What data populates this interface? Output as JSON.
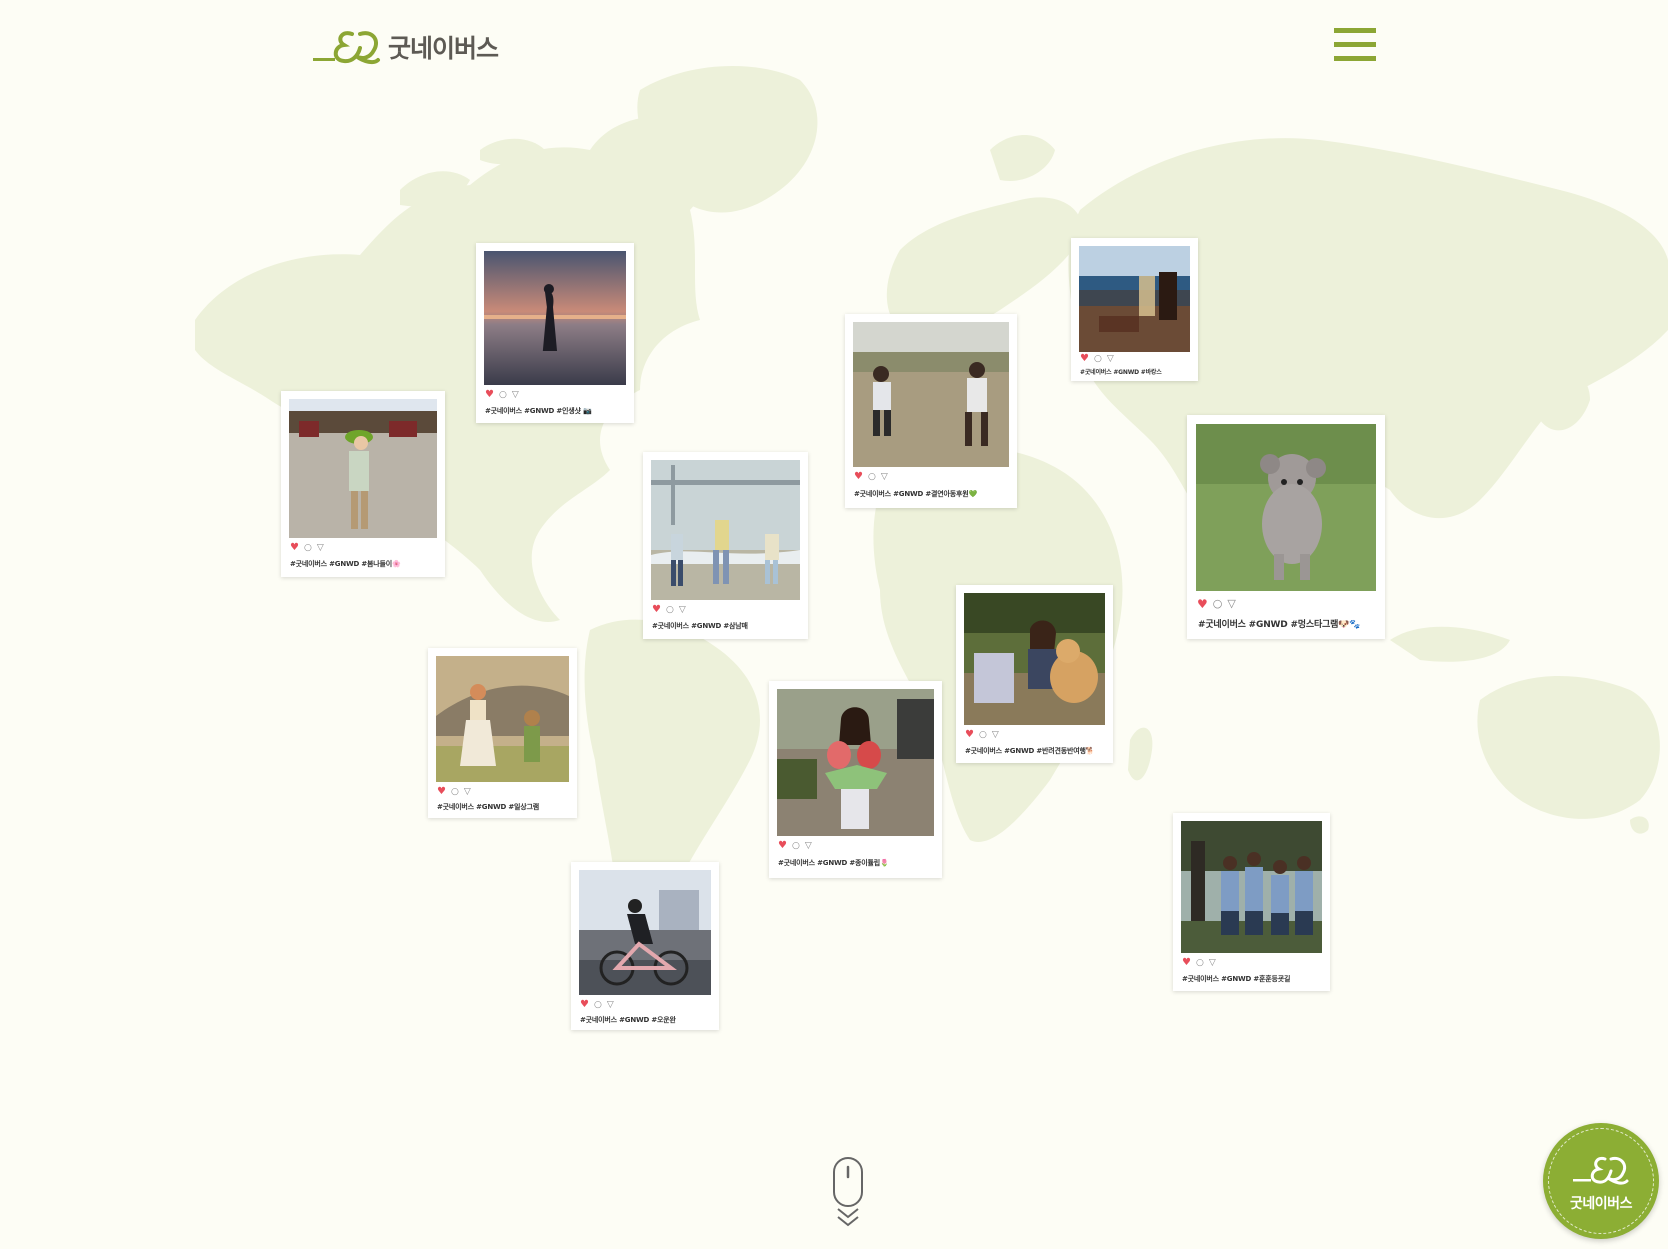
{
  "brand": {
    "name": "굿네이버스",
    "color": "#8ca634"
  },
  "header": {
    "menu_icon": "hamburger-menu-icon"
  },
  "posts": [
    {
      "caption": "#굿네이버스 #GNWD #인생샷 📷",
      "icons": [
        "heart-icon",
        "comment-icon",
        "share-icon"
      ]
    },
    {
      "caption": "#굿네이버스 #GNWD #봄나들이🌸",
      "icons": [
        "heart-icon",
        "comment-icon",
        "share-icon"
      ]
    },
    {
      "caption": "#굿네이버스 #GNWD #삼남매",
      "icons": [
        "heart-icon",
        "comment-icon",
        "share-icon"
      ]
    },
    {
      "caption": "#굿네이버스 #GNWD #결연아동후원💚",
      "icons": [
        "heart-icon",
        "comment-icon",
        "share-icon"
      ]
    },
    {
      "caption": "#굿네이버스 #GNWD #바캉스",
      "icons": [
        "heart-icon",
        "comment-icon",
        "share-icon"
      ]
    },
    {
      "caption": "#굿네이버스 #GNWD #멍스타그램🐶🐾",
      "icons": [
        "heart-icon",
        "comment-icon",
        "share-icon"
      ]
    },
    {
      "caption": "#굿네이버스 #GNWD #반려견동반여행🐕",
      "icons": [
        "heart-icon",
        "comment-icon",
        "share-icon"
      ]
    },
    {
      "caption": "#굿네이버스 #GNWD #일상그램",
      "icons": [
        "heart-icon",
        "comment-icon",
        "share-icon"
      ]
    },
    {
      "caption": "#굿네이버스 #GNWD #종이튤립🌷",
      "icons": [
        "heart-icon",
        "comment-icon",
        "share-icon"
      ]
    },
    {
      "caption": "#굿네이버스 #GNWD #오운완",
      "icons": [
        "heart-icon",
        "comment-icon",
        "share-icon"
      ]
    },
    {
      "caption": "#굿네이버스 #GNWD #훈훈등굣길",
      "icons": [
        "heart-icon",
        "comment-icon",
        "share-icon"
      ]
    }
  ],
  "icons": {
    "heart": "♥",
    "comment": "○",
    "send": "▽"
  },
  "scroll_indicator": "mouse-scroll-icon",
  "floating_badge": {
    "label": "굿네이버스"
  }
}
